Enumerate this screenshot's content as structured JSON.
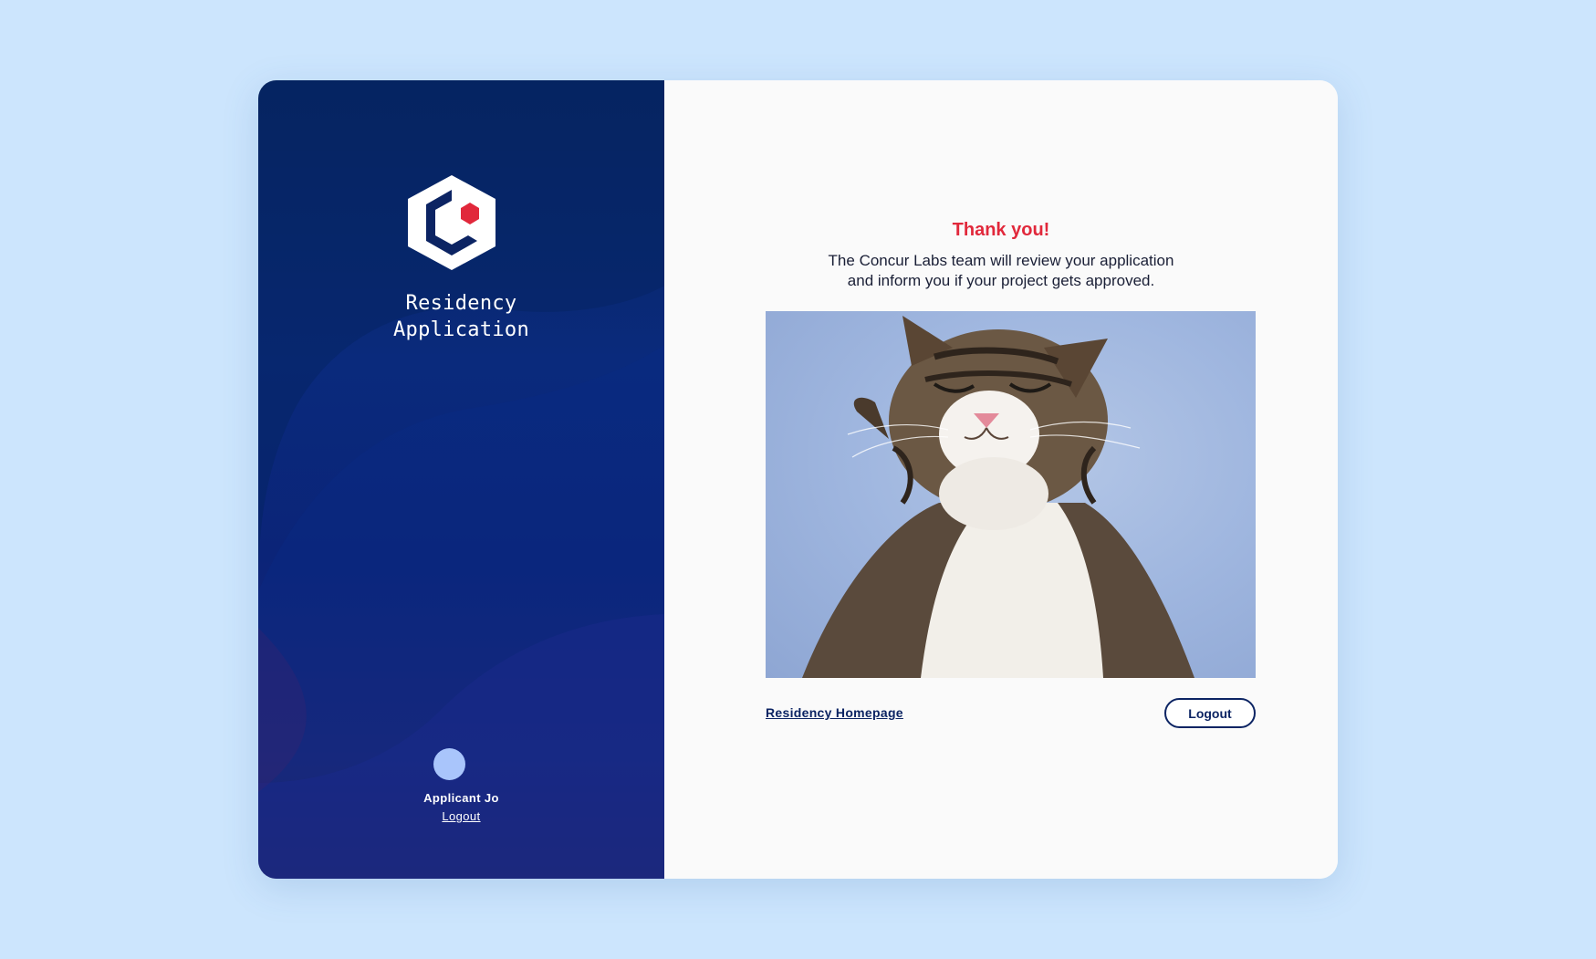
{
  "sidebar": {
    "title_line1": "Residency",
    "title_line2": "Application",
    "logo_icon": "concur-labs-hexagon-logo-icon",
    "user_name": "Applicant Jo",
    "logout_label": "Logout"
  },
  "main": {
    "heading": "Thank you!",
    "message_line1": "The Concur Labs team will review your application",
    "message_line2": "and inform you if your project gets approved.",
    "image_alt": "Happy cat with eyes closed",
    "homepage_link": "Residency Homepage",
    "logout_button": "Logout"
  },
  "colors": {
    "background": "#cce5fd",
    "sidebar_dark": "#06255e",
    "accent_red": "#e1283b",
    "navy": "#0c2463",
    "avatar": "#a9c5fb"
  }
}
